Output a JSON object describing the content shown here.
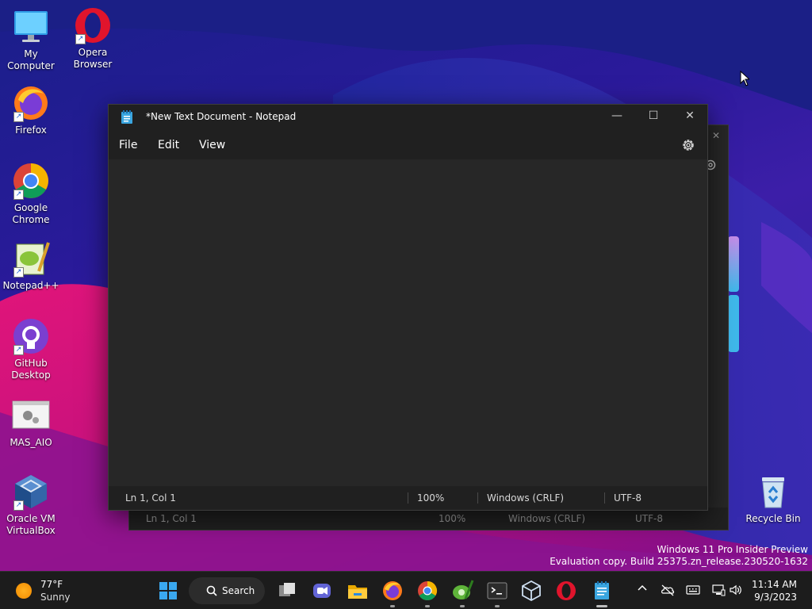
{
  "desktop": {
    "icons": [
      {
        "label_line1": "My Computer",
        "label_line2": ""
      },
      {
        "label_line1": "Opera",
        "label_line2": "Browser"
      },
      {
        "label_line1": "Firefox",
        "label_line2": ""
      },
      {
        "label_line1": "Google",
        "label_line2": "Chrome"
      },
      {
        "label_line1": "Notepad++",
        "label_line2": ""
      },
      {
        "label_line1": "GitHub",
        "label_line2": "Desktop"
      },
      {
        "label_line1": "MAS_AIO",
        "label_line2": ""
      },
      {
        "label_line1": "Oracle VM",
        "label_line2": "VirtualBox"
      },
      {
        "label_line1": "Recycle Bin",
        "label_line2": ""
      }
    ]
  },
  "notepad": {
    "title": "*New Text Document - Notepad",
    "menu": {
      "file": "File",
      "edit": "Edit",
      "view": "View"
    },
    "status": {
      "position": "Ln 1, Col 1",
      "zoom": "100%",
      "line_ending": "Windows (CRLF)",
      "encoding": "UTF-8"
    },
    "controls": {
      "minimize": "—",
      "maximize": "☐",
      "close": "✕"
    }
  },
  "notepad_back": {
    "status": {
      "position": "Ln 1, Col 1",
      "zoom": "100%",
      "line_ending": "Windows (CRLF)",
      "encoding": "UTF-8"
    }
  },
  "watermark": {
    "line1": "Windows 11 Pro Insider Preview",
    "line2": "Evaluation copy. Build 25375.zn_release.230520-1632"
  },
  "taskbar": {
    "weather": {
      "temp": "77°F",
      "condition": "Sunny"
    },
    "search_label": "Search",
    "clock": {
      "time": "11:14 AM",
      "date": "9/3/2023"
    },
    "tray_chevron": "^"
  },
  "colors": {
    "accent": "#0078d4",
    "taskbar": "#1c1c1c",
    "window": "#202020",
    "editor": "#272727"
  }
}
